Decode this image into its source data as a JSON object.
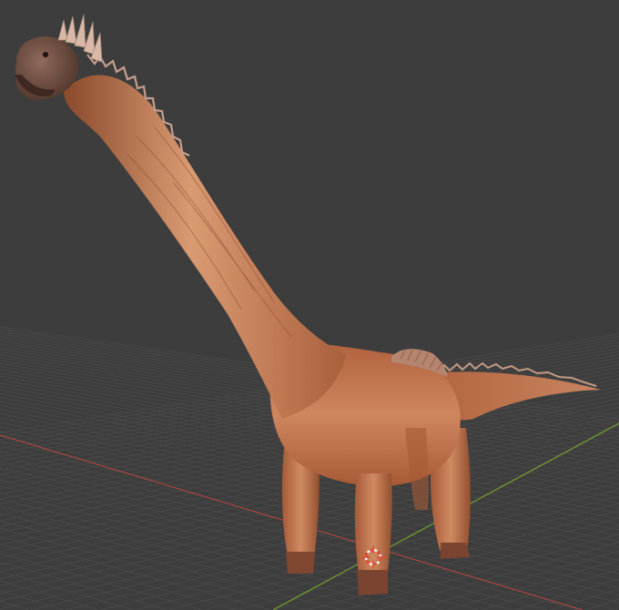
{
  "viewport": {
    "background_color": "#3d3d3d",
    "grid_color": "#4a4a4a",
    "grid_color_dark": "#363636",
    "x_axis_color": "#a04545",
    "y_axis_color": "#6f9b2e",
    "cursor_color_primary": "#e24a3a",
    "cursor_color_secondary": "#f2f2f2"
  },
  "model": {
    "primary_color": "#c97c55",
    "shadow_color": "#8a4a2c",
    "highlight_color": "#e0a37e",
    "head_color": "#6e4c3f",
    "spike_color": "#d8b8a6"
  },
  "icons": {
    "cursor": "3d-cursor-icon"
  }
}
